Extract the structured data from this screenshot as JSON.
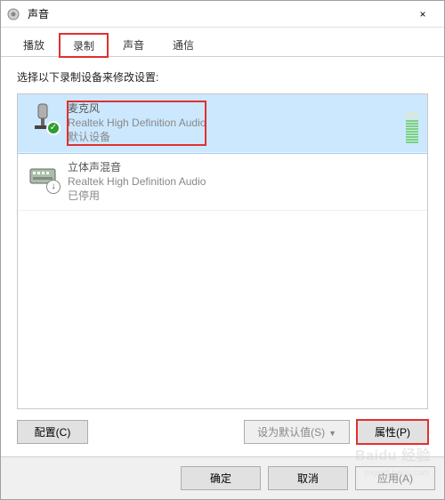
{
  "window": {
    "title": "声音",
    "close_label": "×"
  },
  "tabs": [
    {
      "label": "播放",
      "active": false
    },
    {
      "label": "录制",
      "active": true,
      "highlight": true
    },
    {
      "label": "声音",
      "active": false
    },
    {
      "label": "通信",
      "active": false
    }
  ],
  "instruction": "选择以下录制设备来修改设置:",
  "devices": [
    {
      "name": "麦克风",
      "subtitle": "Realtek High Definition Audio",
      "status": "默认设备",
      "icon": "mic",
      "badge": "check",
      "selected": true,
      "highlight": true,
      "show_meter": true
    },
    {
      "name": "立体声混音",
      "subtitle": "Realtek High Definition Audio",
      "status": "已停用",
      "icon": "mixer",
      "badge": "down",
      "selected": false,
      "highlight": false,
      "show_meter": false
    }
  ],
  "buttons": {
    "configure": "配置(C)",
    "set_default": "设为默认值(S)",
    "properties": "属性(P)"
  },
  "footer": {
    "ok": "确定",
    "cancel": "取消",
    "apply": "应用(A)"
  },
  "watermark": {
    "main": "Baidu 经验",
    "sub": "jingyan.baidu.com"
  }
}
